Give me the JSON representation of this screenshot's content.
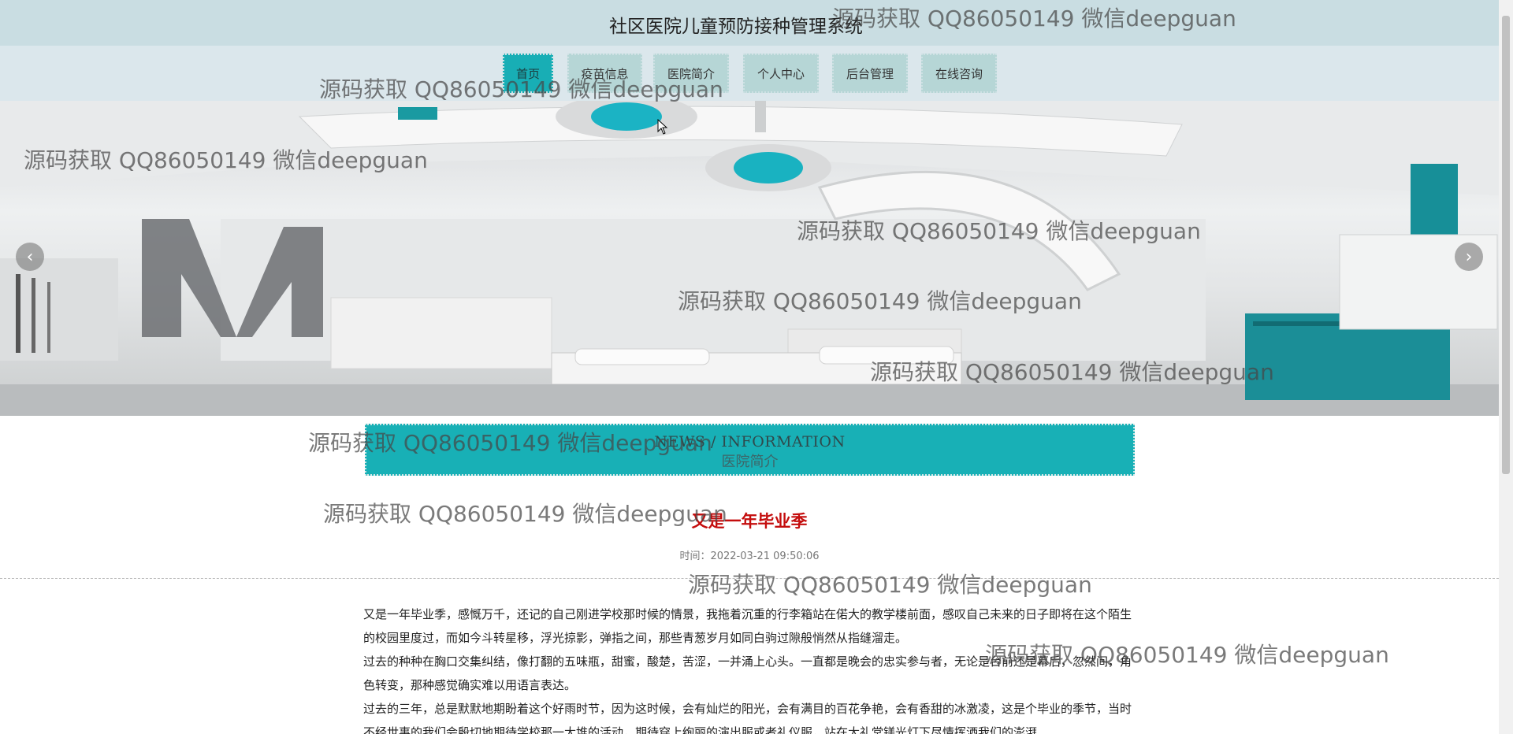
{
  "header": {
    "title": "社区医院儿童预防接种管理系统"
  },
  "nav": {
    "items": [
      {
        "label": "首页"
      },
      {
        "label": "疫苗信息"
      },
      {
        "label": "医院简介"
      },
      {
        "label": "个人中心"
      },
      {
        "label": "后台管理"
      },
      {
        "label": "在线咨询"
      }
    ],
    "active": "首页"
  },
  "banner": {
    "prev_icon": "chevron-left-icon",
    "next_icon": "chevron-right-icon"
  },
  "section": {
    "title_en": "NEWS / INFORMATION",
    "title_cn": "医院简介"
  },
  "article": {
    "title": "又是一年毕业季",
    "time_label": "时间：",
    "time_value": "2022-03-21 09:50:06",
    "paragraphs": [
      "又是一年毕业季，感慨万千，还记的自己刚进学校那时候的情景，我拖着沉重的行李箱站在偌大的教学楼前面，感叹自己未来的日子即将在这个陌生的校园里度过，而如今斗转星移，浮光掠影，弹指之间，那些青葱岁月如同白驹过隙般悄然从指缝溜走。",
      "过去的种种在胸口交集纠结，像打翻的五味瓶，甜蜜，酸楚，苦涩，一并涌上心头。一直都是晚会的忠实参与者，无论是台前还是幕后，忽然间，角色转变，那种感觉确实难以用语言表达。",
      "过去的三年，总是默默地期盼着这个好雨时节，因为这时候，会有灿烂的阳光，会有满目的百花争艳，会有香甜的冰激凌，这是个毕业的季节，当时不经世事的我们会殷切地期待学校那一大堆的活动，期待穿上绚丽的演出服或者礼仪服，站在大礼堂镁光灯下尽情挥洒我们的澎湃"
    ]
  },
  "watermark": {
    "text": "源码获取 QQ86050149 微信deepguan"
  }
}
